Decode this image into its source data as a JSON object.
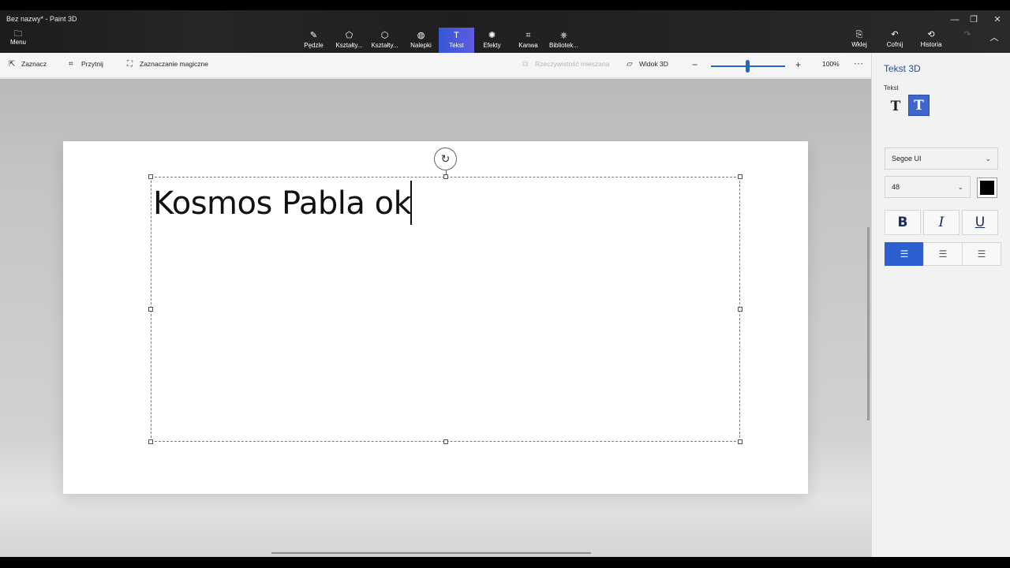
{
  "window": {
    "title": "Bez nazwy* - Paint 3D",
    "minimize_glyph": "—",
    "maximize_glyph": "❐",
    "close_glyph": "✕"
  },
  "ribbon": {
    "menu_label": "Menu",
    "tools": [
      {
        "label": "Pędzle",
        "icon": "brush-icon",
        "glyph": "✎"
      },
      {
        "label": "Kształty...",
        "icon": "shapes-2d-icon",
        "glyph": "⬠"
      },
      {
        "label": "Kształty...",
        "icon": "shapes-3d-icon",
        "glyph": "⬡"
      },
      {
        "label": "Nalepki",
        "icon": "sticker-icon",
        "glyph": "◍"
      },
      {
        "label": "Tekst",
        "icon": "text-icon",
        "glyph": "T"
      },
      {
        "label": "Efekty",
        "icon": "effects-icon",
        "glyph": "✺"
      },
      {
        "label": "Kanwa",
        "icon": "canvas-icon",
        "glyph": "⌗"
      },
      {
        "label": "Bibliotek...",
        "icon": "library-icon",
        "glyph": "⎈"
      }
    ],
    "right_tools": [
      {
        "label": "Wklej",
        "icon": "paste-icon",
        "glyph": "📋"
      },
      {
        "label": "Cofnij",
        "icon": "undo-icon",
        "glyph": "↶"
      },
      {
        "label": "Historia",
        "icon": "history-icon",
        "glyph": "⟲"
      },
      {
        "label": "",
        "icon": "redo-icon",
        "glyph": "↷"
      },
      {
        "label": "",
        "icon": "collapse-icon",
        "glyph": "︿"
      }
    ]
  },
  "toolbar2": {
    "select": "Zaznacz",
    "crop": "Przytnij",
    "magic_select": "Zaznaczanie magiczne",
    "mixed_reality": "Rzeczywistość mieszana",
    "view_3d": "Widok 3D",
    "zoom": "100%",
    "more": "···"
  },
  "canvas": {
    "text": "Kosmos Pabla ok"
  },
  "panel": {
    "title": "Tekst 3D",
    "subtitle": "Tekst",
    "type_2d_glyph": "T",
    "type_3d_glyph": "T",
    "font": "Segoe UI",
    "size": "48",
    "color": "#000000",
    "bold": "B",
    "italic": "I",
    "underline": "U",
    "align_left_glyph": "☰",
    "align_center_glyph": "☰",
    "align_right_glyph": "☰"
  }
}
